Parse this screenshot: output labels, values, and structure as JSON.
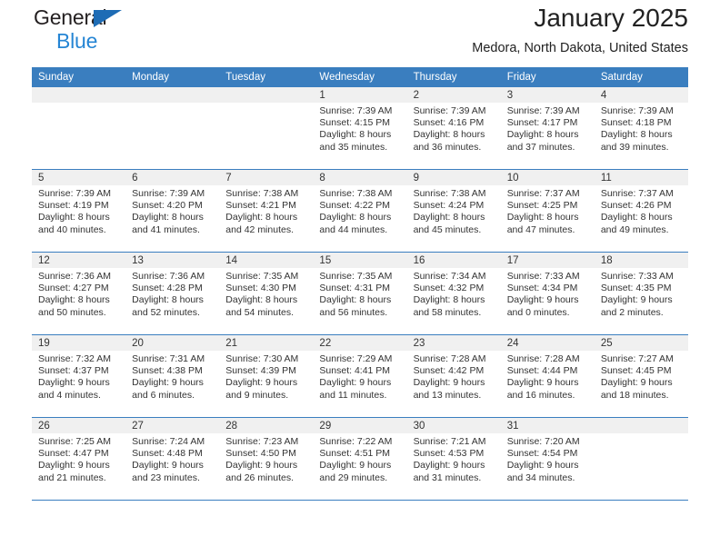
{
  "brand": {
    "name_part1": "General",
    "name_part2": "Blue",
    "triangle_color": "#1e6cb5",
    "blue_text_color": "#2585d4"
  },
  "header": {
    "title": "January 2025",
    "subtitle": "Medora, North Dakota, United States"
  },
  "theme": {
    "header_blue": "#3a7ebf",
    "daynum_band": "#f0f0f0",
    "text": "#333333"
  },
  "calendar": {
    "weekday_headers": [
      "Sunday",
      "Monday",
      "Tuesday",
      "Wednesday",
      "Thursday",
      "Friday",
      "Saturday"
    ],
    "labels": {
      "sunrise_prefix": "Sunrise:",
      "sunset_prefix": "Sunset:",
      "daylight_prefix": "Daylight:"
    },
    "weeks": [
      [
        {
          "day": "",
          "empty": true
        },
        {
          "day": "",
          "empty": true
        },
        {
          "day": "",
          "empty": true
        },
        {
          "day": "1",
          "sunrise": "Sunrise: 7:39 AM",
          "sunset": "Sunset: 4:15 PM",
          "daylight_line1": "Daylight: 8 hours",
          "daylight_line2": "and 35 minutes."
        },
        {
          "day": "2",
          "sunrise": "Sunrise: 7:39 AM",
          "sunset": "Sunset: 4:16 PM",
          "daylight_line1": "Daylight: 8 hours",
          "daylight_line2": "and 36 minutes."
        },
        {
          "day": "3",
          "sunrise": "Sunrise: 7:39 AM",
          "sunset": "Sunset: 4:17 PM",
          "daylight_line1": "Daylight: 8 hours",
          "daylight_line2": "and 37 minutes."
        },
        {
          "day": "4",
          "sunrise": "Sunrise: 7:39 AM",
          "sunset": "Sunset: 4:18 PM",
          "daylight_line1": "Daylight: 8 hours",
          "daylight_line2": "and 39 minutes."
        }
      ],
      [
        {
          "day": "5",
          "sunrise": "Sunrise: 7:39 AM",
          "sunset": "Sunset: 4:19 PM",
          "daylight_line1": "Daylight: 8 hours",
          "daylight_line2": "and 40 minutes."
        },
        {
          "day": "6",
          "sunrise": "Sunrise: 7:39 AM",
          "sunset": "Sunset: 4:20 PM",
          "daylight_line1": "Daylight: 8 hours",
          "daylight_line2": "and 41 minutes."
        },
        {
          "day": "7",
          "sunrise": "Sunrise: 7:38 AM",
          "sunset": "Sunset: 4:21 PM",
          "daylight_line1": "Daylight: 8 hours",
          "daylight_line2": "and 42 minutes."
        },
        {
          "day": "8",
          "sunrise": "Sunrise: 7:38 AM",
          "sunset": "Sunset: 4:22 PM",
          "daylight_line1": "Daylight: 8 hours",
          "daylight_line2": "and 44 minutes."
        },
        {
          "day": "9",
          "sunrise": "Sunrise: 7:38 AM",
          "sunset": "Sunset: 4:24 PM",
          "daylight_line1": "Daylight: 8 hours",
          "daylight_line2": "and 45 minutes."
        },
        {
          "day": "10",
          "sunrise": "Sunrise: 7:37 AM",
          "sunset": "Sunset: 4:25 PM",
          "daylight_line1": "Daylight: 8 hours",
          "daylight_line2": "and 47 minutes."
        },
        {
          "day": "11",
          "sunrise": "Sunrise: 7:37 AM",
          "sunset": "Sunset: 4:26 PM",
          "daylight_line1": "Daylight: 8 hours",
          "daylight_line2": "and 49 minutes."
        }
      ],
      [
        {
          "day": "12",
          "sunrise": "Sunrise: 7:36 AM",
          "sunset": "Sunset: 4:27 PM",
          "daylight_line1": "Daylight: 8 hours",
          "daylight_line2": "and 50 minutes."
        },
        {
          "day": "13",
          "sunrise": "Sunrise: 7:36 AM",
          "sunset": "Sunset: 4:28 PM",
          "daylight_line1": "Daylight: 8 hours",
          "daylight_line2": "and 52 minutes."
        },
        {
          "day": "14",
          "sunrise": "Sunrise: 7:35 AM",
          "sunset": "Sunset: 4:30 PM",
          "daylight_line1": "Daylight: 8 hours",
          "daylight_line2": "and 54 minutes."
        },
        {
          "day": "15",
          "sunrise": "Sunrise: 7:35 AM",
          "sunset": "Sunset: 4:31 PM",
          "daylight_line1": "Daylight: 8 hours",
          "daylight_line2": "and 56 minutes."
        },
        {
          "day": "16",
          "sunrise": "Sunrise: 7:34 AM",
          "sunset": "Sunset: 4:32 PM",
          "daylight_line1": "Daylight: 8 hours",
          "daylight_line2": "and 58 minutes."
        },
        {
          "day": "17",
          "sunrise": "Sunrise: 7:33 AM",
          "sunset": "Sunset: 4:34 PM",
          "daylight_line1": "Daylight: 9 hours",
          "daylight_line2": "and 0 minutes."
        },
        {
          "day": "18",
          "sunrise": "Sunrise: 7:33 AM",
          "sunset": "Sunset: 4:35 PM",
          "daylight_line1": "Daylight: 9 hours",
          "daylight_line2": "and 2 minutes."
        }
      ],
      [
        {
          "day": "19",
          "sunrise": "Sunrise: 7:32 AM",
          "sunset": "Sunset: 4:37 PM",
          "daylight_line1": "Daylight: 9 hours",
          "daylight_line2": "and 4 minutes."
        },
        {
          "day": "20",
          "sunrise": "Sunrise: 7:31 AM",
          "sunset": "Sunset: 4:38 PM",
          "daylight_line1": "Daylight: 9 hours",
          "daylight_line2": "and 6 minutes."
        },
        {
          "day": "21",
          "sunrise": "Sunrise: 7:30 AM",
          "sunset": "Sunset: 4:39 PM",
          "daylight_line1": "Daylight: 9 hours",
          "daylight_line2": "and 9 minutes."
        },
        {
          "day": "22",
          "sunrise": "Sunrise: 7:29 AM",
          "sunset": "Sunset: 4:41 PM",
          "daylight_line1": "Daylight: 9 hours",
          "daylight_line2": "and 11 minutes."
        },
        {
          "day": "23",
          "sunrise": "Sunrise: 7:28 AM",
          "sunset": "Sunset: 4:42 PM",
          "daylight_line1": "Daylight: 9 hours",
          "daylight_line2": "and 13 minutes."
        },
        {
          "day": "24",
          "sunrise": "Sunrise: 7:28 AM",
          "sunset": "Sunset: 4:44 PM",
          "daylight_line1": "Daylight: 9 hours",
          "daylight_line2": "and 16 minutes."
        },
        {
          "day": "25",
          "sunrise": "Sunrise: 7:27 AM",
          "sunset": "Sunset: 4:45 PM",
          "daylight_line1": "Daylight: 9 hours",
          "daylight_line2": "and 18 minutes."
        }
      ],
      [
        {
          "day": "26",
          "sunrise": "Sunrise: 7:25 AM",
          "sunset": "Sunset: 4:47 PM",
          "daylight_line1": "Daylight: 9 hours",
          "daylight_line2": "and 21 minutes."
        },
        {
          "day": "27",
          "sunrise": "Sunrise: 7:24 AM",
          "sunset": "Sunset: 4:48 PM",
          "daylight_line1": "Daylight: 9 hours",
          "daylight_line2": "and 23 minutes."
        },
        {
          "day": "28",
          "sunrise": "Sunrise: 7:23 AM",
          "sunset": "Sunset: 4:50 PM",
          "daylight_line1": "Daylight: 9 hours",
          "daylight_line2": "and 26 minutes."
        },
        {
          "day": "29",
          "sunrise": "Sunrise: 7:22 AM",
          "sunset": "Sunset: 4:51 PM",
          "daylight_line1": "Daylight: 9 hours",
          "daylight_line2": "and 29 minutes."
        },
        {
          "day": "30",
          "sunrise": "Sunrise: 7:21 AM",
          "sunset": "Sunset: 4:53 PM",
          "daylight_line1": "Daylight: 9 hours",
          "daylight_line2": "and 31 minutes."
        },
        {
          "day": "31",
          "sunrise": "Sunrise: 7:20 AM",
          "sunset": "Sunset: 4:54 PM",
          "daylight_line1": "Daylight: 9 hours",
          "daylight_line2": "and 34 minutes."
        },
        {
          "day": "",
          "empty": true
        }
      ]
    ]
  }
}
